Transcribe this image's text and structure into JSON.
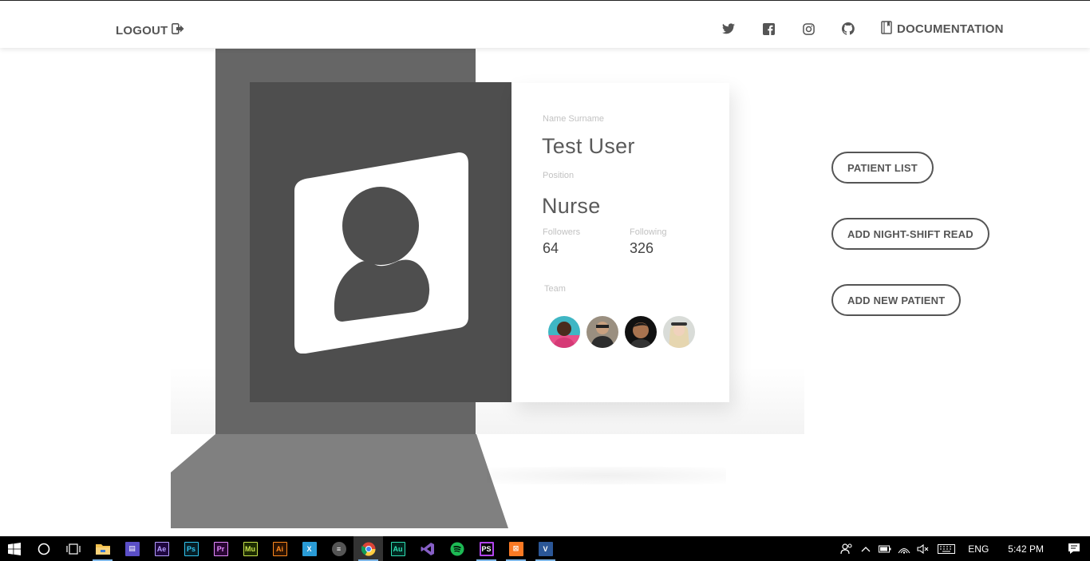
{
  "nav": {
    "logout_label": "LOGOUT",
    "social_icons": [
      "twitter-icon",
      "facebook-icon",
      "instagram-icon",
      "github-icon"
    ],
    "documentation_label": "DOCUMENTATION"
  },
  "profile": {
    "name_label": "Name Surname",
    "name": "Test User",
    "position_label": "Position",
    "position": "Nurse",
    "followers_label": "Followers",
    "followers": "64",
    "following_label": "Following",
    "following": "326",
    "team_label": "Team",
    "team_members": 4
  },
  "actions": {
    "patient_list": "PATIENT LIST",
    "add_night_shift_read": "ADD NIGHT-SHIFT READ",
    "add_new_patient": "ADD NEW PATIENT"
  },
  "taskbar": {
    "apps": [
      {
        "name": "File Explorer",
        "abbr": "",
        "color": "#f2c14e"
      },
      {
        "name": "Visual Studio App",
        "abbr": "",
        "color": "#5b4fc7"
      },
      {
        "name": "After Effects",
        "abbr": "Ae",
        "color": "#1f0740",
        "text": "#b59dff"
      },
      {
        "name": "Photoshop",
        "abbr": "Ps",
        "color": "#061e26",
        "text": "#31c5f0"
      },
      {
        "name": "Premiere",
        "abbr": "Pr",
        "color": "#2a0634",
        "text": "#e58bff"
      },
      {
        "name": "Muse",
        "abbr": "Mu",
        "color": "#1d2c00",
        "text": "#c8e34c"
      },
      {
        "name": "Illustrator",
        "abbr": "Ai",
        "color": "#2b1200",
        "text": "#ff8a1e"
      },
      {
        "name": "Xamarin",
        "abbr": "X",
        "color": "#2a9bd6",
        "text": "#fff"
      },
      {
        "name": "App",
        "abbr": "",
        "color": "#777"
      },
      {
        "name": "Chrome",
        "abbr": "",
        "color": "#db4437"
      },
      {
        "name": "Audition",
        "abbr": "Au",
        "color": "#00261f",
        "text": "#2fe0b4"
      },
      {
        "name": "Visual Studio",
        "abbr": "",
        "color": "#865fc5"
      },
      {
        "name": "Spotify",
        "abbr": "",
        "color": "#1db954"
      },
      {
        "name": "PhpStorm",
        "abbr": "PS",
        "color": "#b345f1",
        "text": "#fff"
      },
      {
        "name": "XAMPP",
        "abbr": "",
        "color": "#fb7a24"
      },
      {
        "name": "Visual Studio Preview",
        "abbr": "V",
        "color": "#2b5797",
        "text": "#fff"
      }
    ],
    "language": "ENG",
    "time": "5:42 PM"
  },
  "colors": {
    "accent_text": "#555555",
    "photo_panel": "#4e4e4e",
    "pillar": "#666666",
    "ramp": "#808080"
  }
}
